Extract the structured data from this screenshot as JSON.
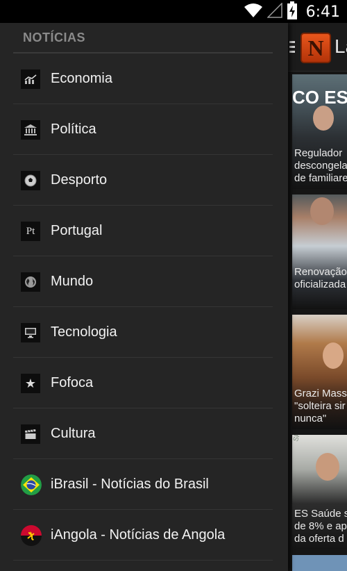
{
  "status_bar": {
    "time": "6:41",
    "icons": [
      "wifi-icon",
      "signal-icon",
      "battery-charging-icon"
    ]
  },
  "app": {
    "title": "La",
    "logo_letter": "N"
  },
  "drawer": {
    "header": "NOTÍCIAS",
    "items": [
      {
        "label": "Economia",
        "icon": "chart-icon"
      },
      {
        "label": "Política",
        "icon": "government-building-icon"
      },
      {
        "label": "Desporto",
        "icon": "soccer-ball-icon"
      },
      {
        "label": "Portugal",
        "icon": "pt-icon",
        "icon_text": "Pt"
      },
      {
        "label": "Mundo",
        "icon": "globe-icon"
      },
      {
        "label": "Tecnologia",
        "icon": "monitor-icon"
      },
      {
        "label": "Fofoca",
        "icon": "star-icon",
        "icon_text": "★"
      },
      {
        "label": "Cultura",
        "icon": "clapperboard-icon"
      },
      {
        "label": "iBrasil - Notícias do Brasil",
        "icon": "brazil-flag-icon"
      },
      {
        "label": "iAngola - Notícias de Angola",
        "icon": "angola-flag-icon"
      }
    ]
  },
  "feed": {
    "cards": [
      {
        "banner": "CO ES",
        "lines": [
          "Regulador",
          "descongela",
          "de familiare"
        ]
      },
      {
        "lines": [
          "Renovação",
          "oficializada"
        ]
      },
      {
        "lines": [
          "Grazi Mass",
          "\"solteira sir",
          "nunca\""
        ]
      },
      {
        "banner_small": "SPIRITO",
        "lines": [
          "ES Saúde s",
          "de 8% e apr",
          "da oferta d"
        ]
      }
    ]
  },
  "colors": {
    "drawer_bg": "#252525",
    "divider": "#353535",
    "header_text": "#8a8a8a",
    "label_text": "#f2f2f2",
    "logo_orange": "#e8561c"
  }
}
